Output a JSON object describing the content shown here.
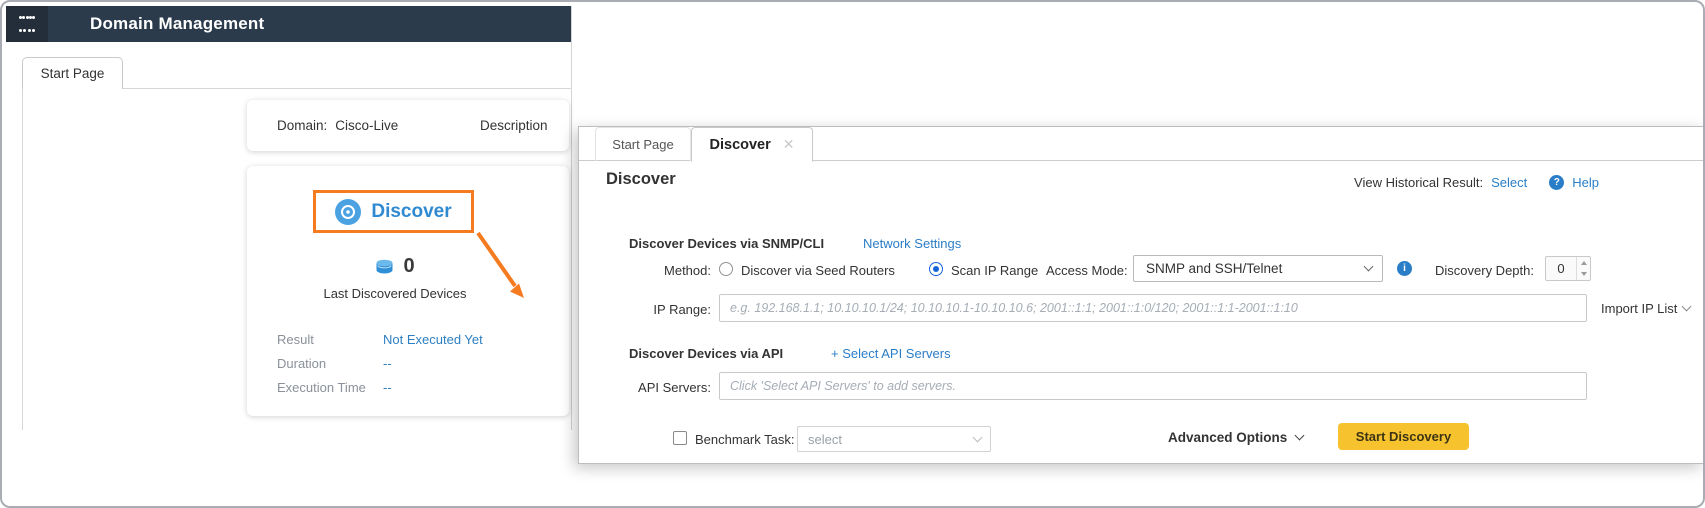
{
  "app": {
    "title": "Domain Management"
  },
  "background_window": {
    "tab_label": "Start Page",
    "domain_card": {
      "domain_label": "Domain:",
      "domain_value": "Cisco-Live",
      "description_label": "Description"
    },
    "discover_card": {
      "discover_button_label": "Discover",
      "device_count": "0",
      "device_count_caption": "Last Discovered Devices",
      "stats": [
        {
          "label": "Result",
          "value": "Not Executed Yet"
        },
        {
          "label": "Duration",
          "value": "--"
        },
        {
          "label": "Execution Time",
          "value": "--"
        }
      ]
    },
    "annotation_color": "#f47b20"
  },
  "dialog": {
    "tabs": [
      {
        "label": "Start Page",
        "active": false
      },
      {
        "label": "Discover",
        "active": true
      }
    ],
    "close_icon_glyph": "✕",
    "heading": "Discover",
    "historical": {
      "label": "View Historical Result:",
      "select_link": "Select",
      "help_icon_glyph": "?",
      "help_link": "Help"
    },
    "snmp_section": {
      "title": "Discover Devices via SNMP/CLI",
      "network_settings_link": "Network Settings",
      "method_label": "Method:",
      "method_options": [
        {
          "label": "Discover via Seed Routers",
          "selected": false
        },
        {
          "label": "Scan IP Range",
          "selected": true
        }
      ],
      "access_mode_label": "Access Mode:",
      "access_mode_value": "SNMP and SSH/Telnet",
      "info_icon_glyph": "i",
      "discovery_depth_label": "Discovery Depth:",
      "discovery_depth_value": "0",
      "ip_range_label": "IP Range:",
      "ip_range_placeholder": "e.g. 192.168.1.1; 10.10.10.1/24; 10.10.10.1-10.10.10.6; 2001::1:1; 2001::1:0/120; 2001::1:1-2001::1:10",
      "import_ip_list_label": "Import IP List"
    },
    "api_section": {
      "title": "Discover Devices via API",
      "select_api_servers_link": "+ Select API Servers",
      "api_servers_label": "API Servers:",
      "api_servers_placeholder": "Click 'Select API Servers' to add servers."
    },
    "footer": {
      "benchmark_label": "Benchmark Task:",
      "benchmark_select_value": "select",
      "advanced_options_label": "Advanced Options",
      "start_discovery_label": "Start Discovery"
    }
  },
  "colors": {
    "header_bg": "#2b3b4c",
    "accent_blue": "#2a7ec7",
    "radio_selected": "#1565d8",
    "annotation_orange": "#f47b20",
    "start_button_yellow": "#f6c32f"
  }
}
